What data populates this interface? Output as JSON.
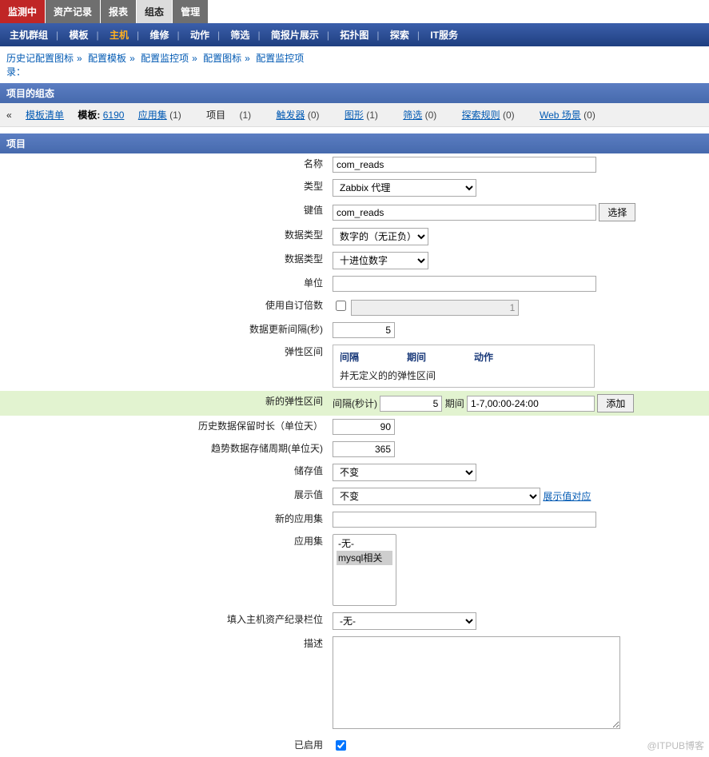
{
  "watermark": "@ITPUB博客",
  "toptabs": [
    "监测中",
    "资产记录",
    "报表",
    "组态",
    "管理"
  ],
  "toptabs_active": 3,
  "subnav": {
    "items": [
      "主机群组",
      "模板",
      "主机",
      "维修",
      "动作",
      "筛选",
      "简报片展示",
      "拓扑图",
      "探索",
      "IT服务"
    ],
    "active": 2
  },
  "history": {
    "label": "历史记录：",
    "items": [
      "配置图标",
      "配置模板",
      "配置监控项",
      "配置图标",
      "配置监控项"
    ]
  },
  "section1": "项目的组态",
  "listbar": {
    "back": "« ",
    "back_label": "模板清单",
    "tpl_label": "模板:",
    "tpl_value": "6190",
    "items": [
      {
        "label": "应用集",
        "count": "(1)",
        "link": true
      },
      {
        "label": "项目",
        "count": "(1)",
        "link": false
      },
      {
        "label": "触发器",
        "count": "(0)",
        "link": true
      },
      {
        "label": "图形",
        "count": "(1)",
        "link": true
      },
      {
        "label": "筛选",
        "count": "(0)",
        "link": true
      },
      {
        "label": "探索规则",
        "count": "(0)",
        "link": true
      },
      {
        "label": "Web 场景",
        "count": "(0)",
        "link": true
      }
    ]
  },
  "section2": "项目",
  "form": {
    "name": {
      "label": "名称",
      "value": "com_reads"
    },
    "type": {
      "label": "类型",
      "value": "Zabbix 代理"
    },
    "key": {
      "label": "键值",
      "value": "com_reads",
      "select": "选择"
    },
    "dtype": {
      "label": "数据类型",
      "value": "数字的（无正负）"
    },
    "dfmt": {
      "label": "数据类型",
      "value": "十进位数字"
    },
    "unit": {
      "label": "单位",
      "value": ""
    },
    "mult": {
      "label": "使用自订倍数",
      "checked": false,
      "factor": "1"
    },
    "interval": {
      "label": "数据更新间隔(秒)",
      "value": "5"
    },
    "flex": {
      "label": "弹性区间",
      "cols": [
        "间隔",
        "期间",
        "动作"
      ],
      "empty": "并无定义的的弹性区间"
    },
    "newflex": {
      "label": "新的弹性区间",
      "int_label": "间隔(秒计)",
      "int_val": "5",
      "per_label": "期间",
      "per_val": "1-7,00:00-24:00",
      "add": "添加"
    },
    "hist": {
      "label": "历史数据保留时长（单位天）",
      "value": "90"
    },
    "trend": {
      "label": "趋势数据存储周期(单位天)",
      "value": "365"
    },
    "store": {
      "label": "储存值",
      "value": "不变"
    },
    "show": {
      "label": "展示值",
      "value": "不变",
      "link": "展示值对应"
    },
    "newapp": {
      "label": "新的应用集",
      "value": ""
    },
    "apps": {
      "label": "应用集",
      "options": [
        "-无-",
        "mysql相关"
      ]
    },
    "inv": {
      "label": "填入主机资产纪录栏位",
      "value": "-无-"
    },
    "desc": {
      "label": "描述",
      "value": ""
    },
    "enabled": {
      "label": "已启用",
      "checked": true
    }
  }
}
